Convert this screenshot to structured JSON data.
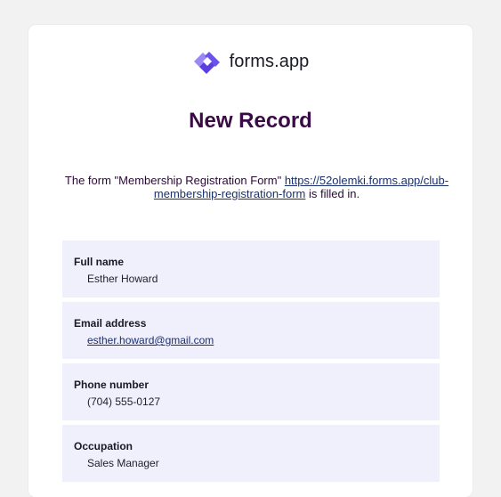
{
  "brand": {
    "name": "forms.app",
    "mark_colors": [
      "#5b3fe0",
      "#9b87f5"
    ]
  },
  "title": "New Record",
  "intro": {
    "prefix": "The form \"Membership Registration Form\" ",
    "link_text": "https://52olemki.forms.app/club-membership-registration-form",
    "suffix": " is filled in."
  },
  "fields": [
    {
      "label": "Full name",
      "value": "Esther Howard"
    },
    {
      "label": "Email address",
      "value": "esther.howard@gmail.com"
    },
    {
      "label": "Phone number",
      "value": "(704) 555-0127"
    },
    {
      "label": "Occupation",
      "value": "Sales Manager"
    }
  ],
  "colors": {
    "background": "#f2f2f3",
    "card": "#ffffff",
    "title": "#3a0a45",
    "link": "#1a2f6e",
    "field_bg": "#f0f0fd"
  }
}
